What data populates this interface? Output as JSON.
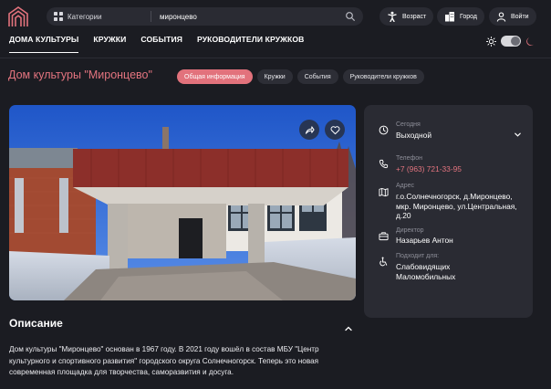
{
  "header": {
    "categories_label": "Категории",
    "search_value": "миронцево",
    "age_label": "Возраст",
    "city_label": "Город",
    "login_label": "Войти"
  },
  "nav": {
    "items": [
      "ДОМА КУЛЬТУРЫ",
      "КРУЖКИ",
      "СОБЫТИЯ",
      "РУКОВОДИТЕЛИ КРУЖКОВ"
    ],
    "active_index": 0
  },
  "theme": {
    "mode": "dark"
  },
  "page": {
    "title": "Дом культуры \"Миронцево\"",
    "tabs": [
      "Общая информация",
      "Кружки",
      "События",
      "Руководители кружков"
    ],
    "active_tab": 0
  },
  "info": {
    "today_label": "Сегодня",
    "today_value": "Выходной",
    "phone_label": "Телефон",
    "phone_value": "+7 (963) 721-33-95",
    "address_label": "Адрес",
    "address_value": "г.о.Солнечногорск, д.Миронцево, мкр. Миронцево, ул.Центральная, д.20",
    "director_label": "Директор",
    "director_value": "Назарьев Антон",
    "suitable_label": "Подходит для:",
    "suitable_value": "Слабовидящих Маломобильных"
  },
  "description": {
    "title": "Описание",
    "text": "Дом культуры \"Миронцево\" основан в 1967 году. В 2021 году вошёл в состав МБУ \"Центр культурного и спортивного развития\" городского округа Солнечногорск. Теперь это новая современная площадка для творчества, саморазвития и досуга."
  },
  "colors": {
    "background": "#1b1c22",
    "surface": "#2a2b33",
    "accent": "#e2727c",
    "muted": "#8d8e98"
  }
}
